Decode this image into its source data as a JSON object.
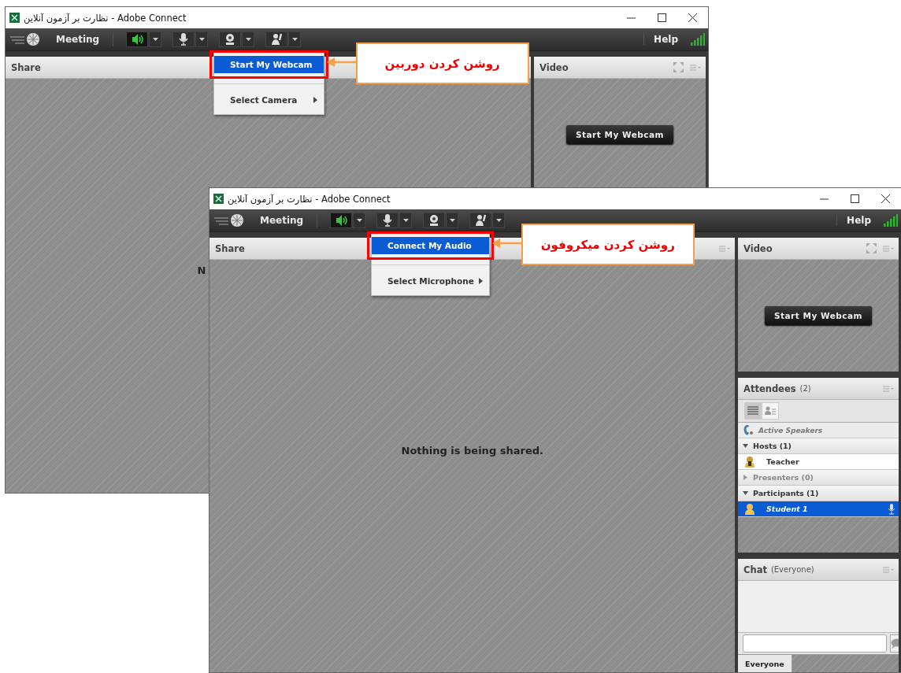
{
  "windows": [
    {
      "title": "نظارت بر آزمون آنلاین - Adobe Connect",
      "toolbar": {
        "menu": "Meeting",
        "help": "Help",
        "speaker_on": true
      },
      "share": {
        "title": "Share",
        "message": "N"
      },
      "video": {
        "title": "Video",
        "button": "Start My Webcam"
      },
      "menu": {
        "items": [
          {
            "label": "Start My Webcam",
            "selected": true,
            "submenu": false
          },
          {
            "label": "Select Camera",
            "selected": false,
            "submenu": true
          }
        ],
        "callout": "روشن کردن دوربین"
      }
    },
    {
      "title": "نظارت بر آزمون آنلاین - Adobe Connect",
      "toolbar": {
        "menu": "Meeting",
        "help": "Help",
        "speaker_on": true
      },
      "share": {
        "title": "Share",
        "message": "Nothing is being shared."
      },
      "video": {
        "title": "Video",
        "button": "Start My Webcam"
      },
      "menu": {
        "items": [
          {
            "label": "Connect My Audio",
            "selected": true,
            "submenu": false
          },
          {
            "label": "Select Microphone",
            "selected": false,
            "submenu": true
          }
        ],
        "callout": "روشن کردن میکروفون"
      },
      "attendees": {
        "title": "Attendees",
        "count": "(2)",
        "active_speakers": "Active Speakers",
        "groups": [
          {
            "name": "Hosts (1)",
            "expanded": true,
            "disabled": false,
            "members": [
              {
                "name": "Teacher",
                "kind": "host",
                "selected": false,
                "microphone": false
              }
            ]
          },
          {
            "name": "Presenters (0)",
            "expanded": false,
            "disabled": true
          },
          {
            "name": "Participants (1)",
            "expanded": true,
            "disabled": false,
            "members": [
              {
                "name": "Student 1",
                "kind": "participant",
                "selected": true,
                "microphone": true
              }
            ]
          }
        ]
      },
      "chat": {
        "title": "Chat",
        "scope": "(Everyone)",
        "tab": "Everyone"
      }
    }
  ]
}
